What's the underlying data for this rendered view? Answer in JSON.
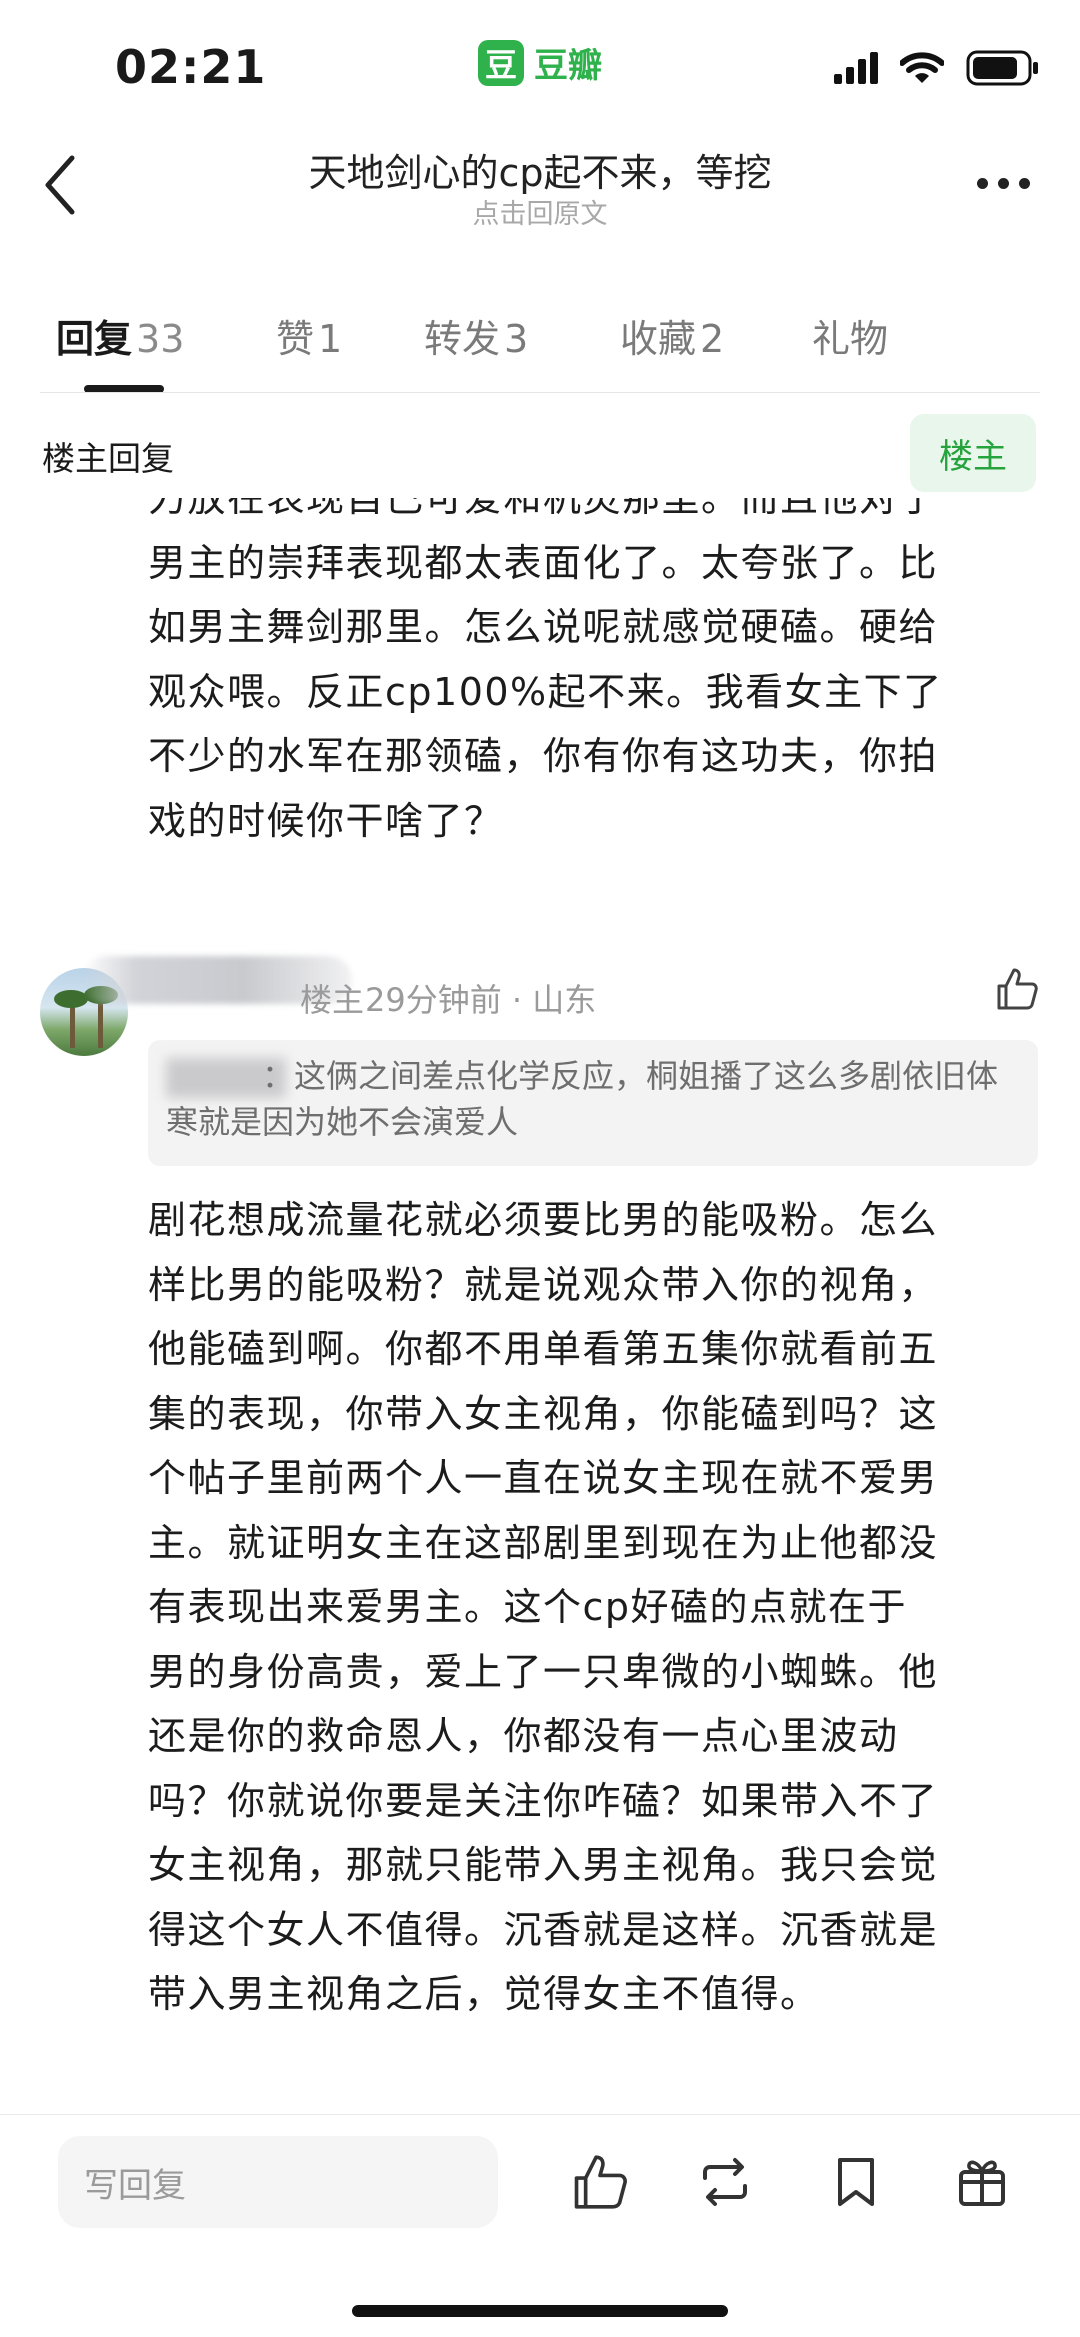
{
  "status_bar": {
    "time": "02:21",
    "app_logo_char": "豆",
    "app_name": "豆瓣"
  },
  "nav": {
    "title": "天地剑心的cp起不来，等挖",
    "subtitle": "点击回原文"
  },
  "tabs": [
    {
      "label": "回复",
      "count": "33",
      "active": true
    },
    {
      "label": "赞",
      "count": "1"
    },
    {
      "label": "转发",
      "count": "3"
    },
    {
      "label": "收藏",
      "count": "2"
    },
    {
      "label": "礼物",
      "count": ""
    }
  ],
  "section": {
    "title": "楼主回复",
    "owner_button": "楼主"
  },
  "clipped_post": {
    "lines": [
      "力放在表现自己可爱和机灵那里。而且他对于",
      "男主的崇拜表现都太表面化了。太夸张了。比",
      "如男主舞剑那里。怎么说呢就感觉硬磕。硬给",
      "观众喂。反正cp100%起不来。我看女主下了",
      "不少的水军在那领磕，你有你有这功夫，你拍",
      "戏的时候你干啥了？"
    ]
  },
  "comment": {
    "owner_tag": "楼主",
    "meta": "29分钟前 · 山东",
    "quote_text": "：这俩之间差点化学反应，桐姐播了这么多剧依旧体寒就是因为她不会演爱人",
    "body_lines": [
      "剧花想成流量花就必须要比男的能吸粉。怎么",
      "样比男的能吸粉？就是说观众带入你的视角，",
      "他能磕到啊。你都不用单看第五集你就看前五",
      "集的表现，你带入女主视角，你能磕到吗？这",
      "个帖子里前两个人一直在说女主现在就不爱男",
      "主。就证明女主在这部剧里到现在为止他都没",
      "有表现出来爱男主。这个cp好磕的点就在于",
      "男的身份高贵，爱上了一只卑微的小蜘蛛。他",
      "还是你的救命恩人，你都没有一点心里波动",
      "吗？你就说你要是关注你咋磕？如果带入不了",
      "女主视角，那就只能带入男主视角。我只会觉",
      "得这个女人不值得。沉香就是这样。沉香就是",
      "带入男主视角之后，觉得女主不值得。"
    ]
  },
  "bottom_bar": {
    "reply_placeholder": "写回复"
  },
  "colors": {
    "accent": "#2fb24c",
    "owner_button_bg": "#e8f6ec",
    "owner_button_text": "#27a33d"
  },
  "icons": [
    "signal-icon",
    "wifi-icon",
    "battery-icon",
    "back-arrow-icon",
    "more-icon",
    "thumbs-up-icon",
    "repost-icon",
    "bookmark-icon",
    "gift-icon"
  ]
}
